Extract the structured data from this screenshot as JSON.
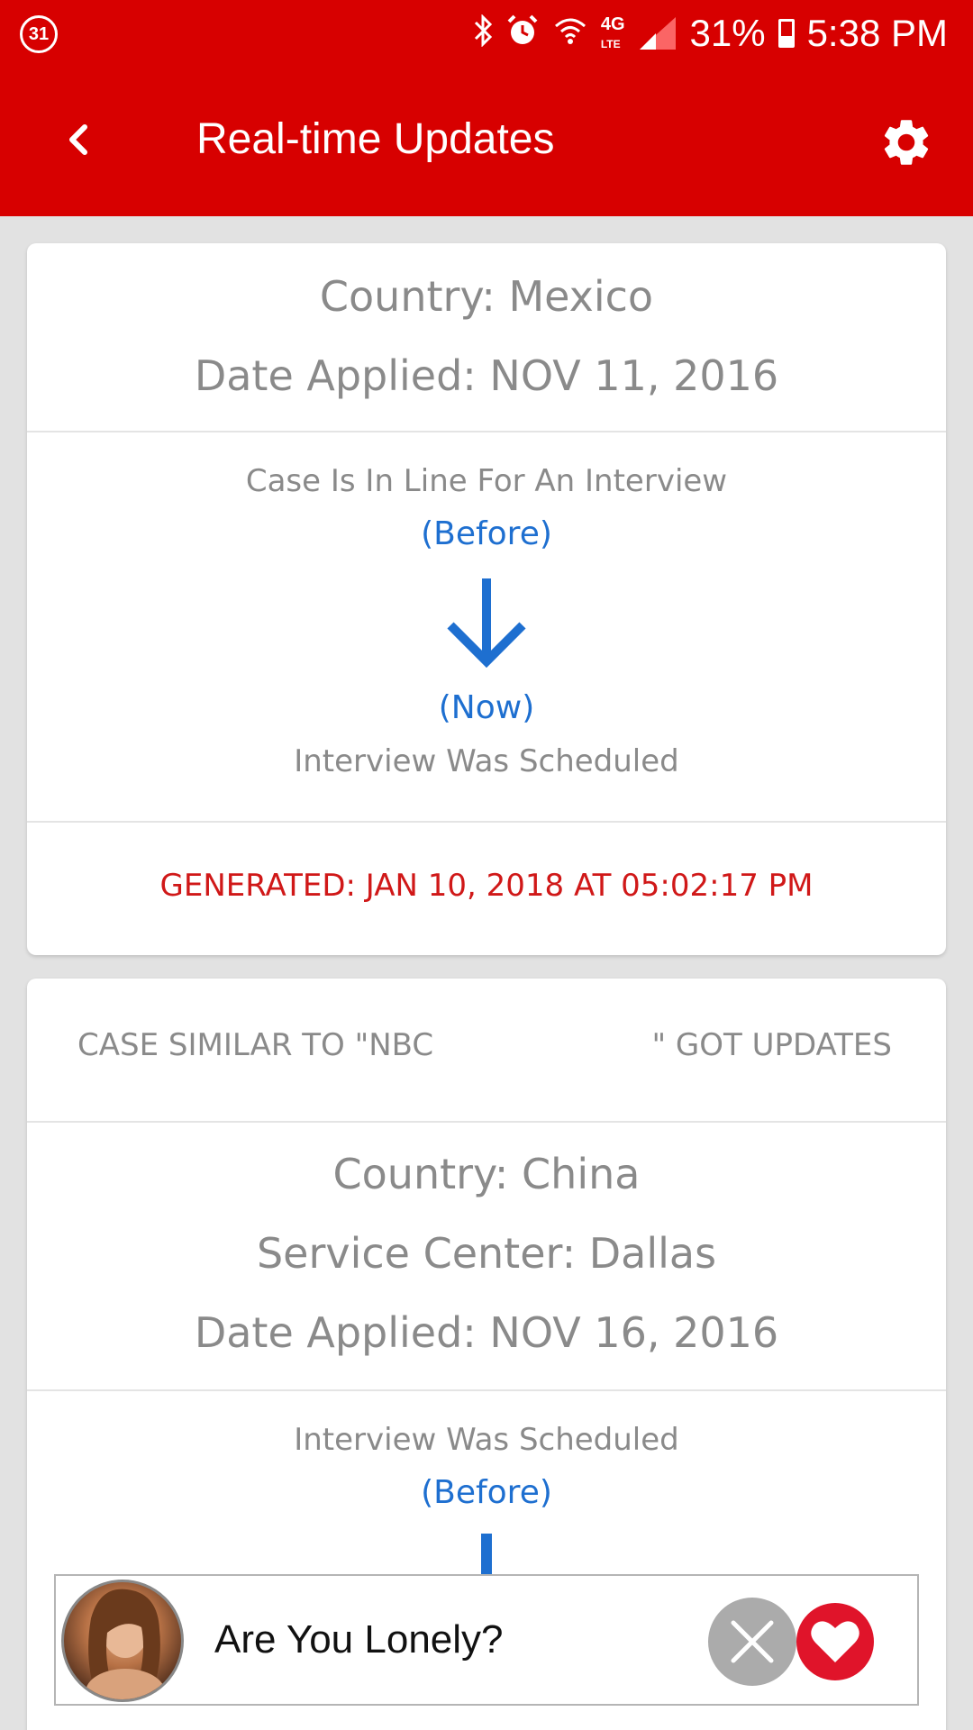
{
  "status_bar": {
    "calendar_badge": "31",
    "battery": "31%",
    "time": "5:38 PM",
    "icons": [
      "calendar-icon",
      "bluetooth-icon",
      "alarm-icon",
      "wifi-icon",
      "4g-lte-icon",
      "signal-icon",
      "battery-icon"
    ],
    "network": "4G LTE"
  },
  "app_bar": {
    "title": "Real-time Updates",
    "back_icon": "chevron-left-icon",
    "settings_icon": "gear-icon"
  },
  "cards": [
    {
      "country": "Country: Mexico",
      "date_applied": "Date Applied: NOV 11, 2016",
      "before_status": "Case Is In Line For An Interview",
      "before_label": "(Before)",
      "now_label": "(Now)",
      "now_status": "Interview Was Scheduled",
      "generated": "GENERATED: JAN 10, 2018 AT 05:02:17 PM"
    },
    {
      "similar_left": "CASE SIMILAR TO \"NBC",
      "similar_right": "\" GOT UPDATES",
      "country": "Country: China",
      "service_center": "Service Center: Dallas",
      "date_applied": "Date Applied: NOV 16, 2016",
      "before_status": "Interview Was Scheduled",
      "before_label": "(Before)"
    }
  ],
  "ad": {
    "text": "Are You Lonely?",
    "close_icon": "close-icon",
    "like_icon": "heart-icon"
  },
  "colors": {
    "primary": "#d70000",
    "accent_blue": "#1e6fd0",
    "generated_red": "#d01818",
    "text_gray": "#8a8a8a"
  }
}
